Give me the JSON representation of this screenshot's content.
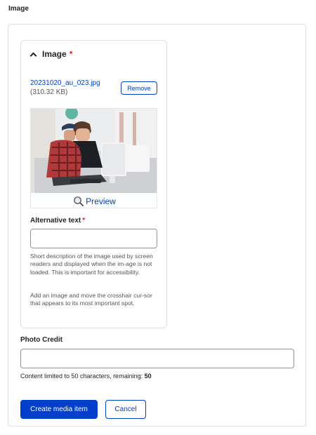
{
  "page": {
    "heading": "Image"
  },
  "image_widget": {
    "summary_label": "Image",
    "required_marker": "*",
    "file_name": "20231020_au_023.jpg",
    "file_size": "(310.32 KB)",
    "remove_label": "Remove",
    "preview_label": "Preview",
    "alt_label": "Alternative text",
    "alt_required_marker": "*",
    "alt_value": "",
    "alt_description": "Short description of the image used by screen readers and displayed when the im-age is not loaded. This is important for accessibility.",
    "focal_description": "Add an image and move the crosshair cur-sor that appears to its most important spot."
  },
  "photo_credit": {
    "label": "Photo Credit",
    "value": "",
    "limit_text": "Content limited to 50 characters, remaining: ",
    "remaining": "50"
  },
  "actions": {
    "create_label": "Create media item",
    "cancel_label": "Cancel"
  },
  "colors": {
    "accent": "#003ecc",
    "required": "#dc2323",
    "border": "#dedfe4"
  }
}
